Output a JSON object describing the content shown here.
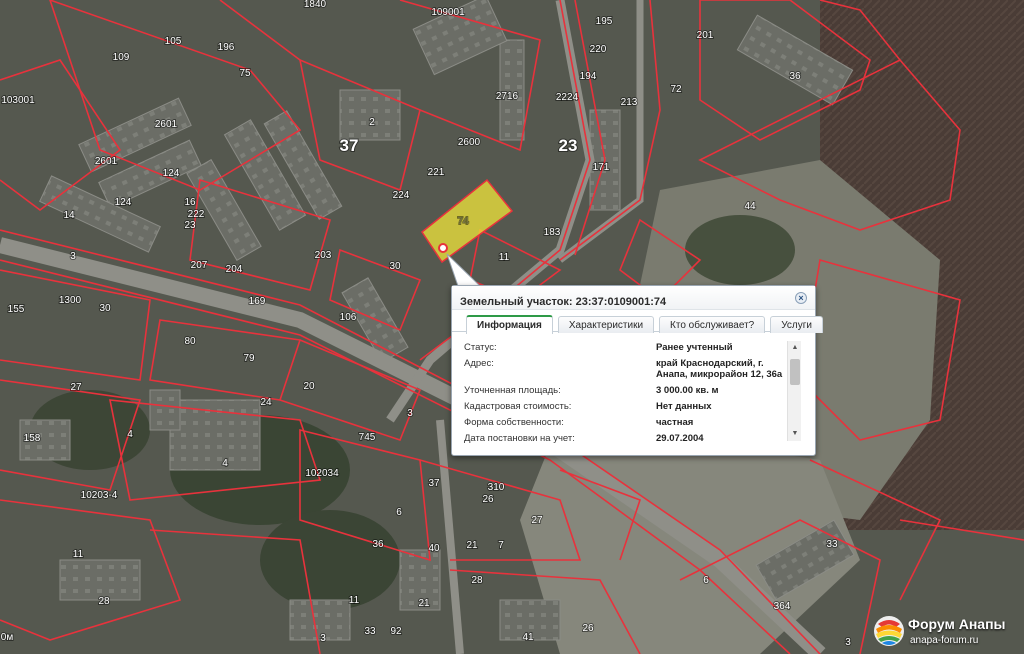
{
  "map": {
    "parcel_labels": [
      "1840",
      "109001",
      "195",
      "201",
      "105",
      "196",
      "75",
      "220",
      "194",
      "109",
      "36",
      "213",
      "2716",
      "2224",
      "103001",
      "72",
      "2",
      "37",
      "2601",
      "2600",
      "23",
      "171",
      "2601",
      "124",
      "222",
      "221",
      "224",
      "74",
      "44",
      "124",
      "16",
      "183",
      "14",
      "11",
      "203",
      "207",
      "204",
      "1300",
      "3",
      "155",
      "30",
      "169",
      "106",
      "30",
      "23",
      "80",
      "79",
      "27",
      "20",
      "24",
      "158",
      "4",
      "4",
      "745",
      "3",
      "102034",
      "37",
      "310",
      "6",
      "26",
      "27",
      "7",
      "33",
      "10203-4",
      "11",
      "40",
      "21",
      "21",
      "28",
      "11",
      "36",
      "6",
      "364",
      "33",
      "3",
      "41",
      "26",
      "92",
      "3",
      "28",
      "7"
    ],
    "highlighted_parcel_label": "74",
    "highlight_color": "#f2e63a",
    "boundary_color": "#e8323c"
  },
  "popup": {
    "title": "Земельный участок: 23:37:0109001:74",
    "close_icon": "×",
    "tabs": [
      {
        "label": "Информация",
        "active": true
      },
      {
        "label": "Характеристики",
        "active": false
      },
      {
        "label": "Кто обслуживает?",
        "active": false
      },
      {
        "label": "Услуги",
        "active": false
      }
    ],
    "rows": [
      {
        "label": "Статус:",
        "value": "Ранее учтенный"
      },
      {
        "label": "Адрес:",
        "value": "край Краснодарский, г. Анапа, микрорайон 12, 36а"
      },
      {
        "label": "Уточненная площадь:",
        "value": "3 000.00 кв. м"
      },
      {
        "label": "Кадастровая стоимость:",
        "value": "Нет данных"
      },
      {
        "label": "Форма собственности:",
        "value": "частная"
      },
      {
        "label": "Дата постановки на учет:",
        "value": "29.07.2004"
      }
    ],
    "scroll_up_icon": "▲",
    "scroll_down_icon": "▼"
  },
  "logo": {
    "title": "Форум Анапы",
    "url": "anapa-forum.ru",
    "colors": [
      "#e53935",
      "#fb8c00",
      "#fdd835",
      "#43a047",
      "#1e88e5"
    ]
  },
  "edge_text": "0м"
}
